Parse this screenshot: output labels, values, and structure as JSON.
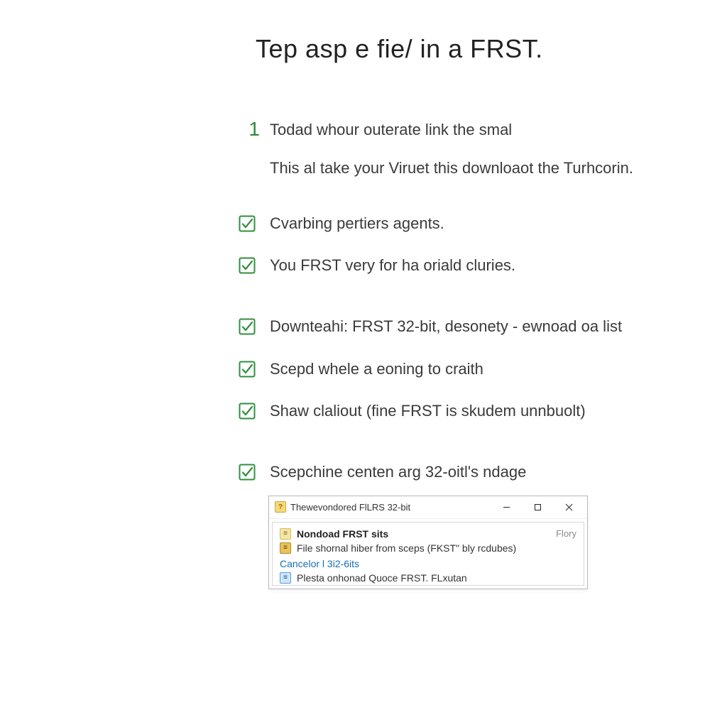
{
  "title": "Tep asp e fie/ in a FRST.",
  "step": {
    "num": "1",
    "title": "Todad whour outerate link the smal",
    "desc": "This al take your Viruet this downloaot the Turhcorin."
  },
  "checks": [
    {
      "text": "Cvarbing pertiers agents.",
      "gap": false
    },
    {
      "text": "You FRST very for ha oriald cluries.",
      "gap": true
    },
    {
      "text": "Downteahi: FRST 32-bit, desonety - ewnoad oa list",
      "gap": false
    },
    {
      "text": "Scepd whele a eoning to craith",
      "gap": false
    },
    {
      "text": "Shaw claliout (fine FRST is skudem unnbuolt)",
      "gap": true
    },
    {
      "text": "Scepchine centen arg 32-oitl's ndage",
      "gap": false
    }
  ],
  "popup": {
    "title": "Thewevondored FlLRS 32-bit",
    "rows": [
      {
        "iconClass": "yellow",
        "text": "Nondoad FRST sits",
        "side": "Flory",
        "bold": true
      },
      {
        "iconClass": "gold",
        "text": "File shornal hiber from sceps (FKST\" bly rcdubes)",
        "side": "",
        "bold": false
      }
    ],
    "link": "Cancelor l 3i2-6its",
    "truncated": {
      "iconClass": "blue",
      "text": "Plesta onhonad Quoce FRST. FLxutan"
    }
  }
}
